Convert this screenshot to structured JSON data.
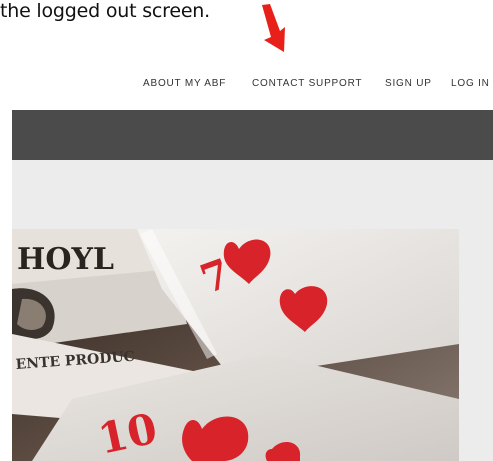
{
  "caption": {
    "text": "the logged out screen."
  },
  "arrow": {
    "icon": "red-arrow-down-icon",
    "color": "#e8201a"
  },
  "nav": {
    "items": [
      {
        "label": "ABOUT MY ABF"
      },
      {
        "label": "CONTACT SUPPORT"
      },
      {
        "label": "SIGN UP"
      },
      {
        "label": "LOG IN"
      }
    ]
  },
  "hero": {
    "image": "playing-cards-photo",
    "card_glyphs": {
      "top": "7",
      "bottom": "10",
      "brand_text": "HOYL",
      "maker_text": "ENTE PRODUC"
    }
  },
  "colors": {
    "dark_bar": "#4b4b4b",
    "page_bg": "#ececec",
    "nav_text": "#333333",
    "card_red": "#d8232a"
  }
}
